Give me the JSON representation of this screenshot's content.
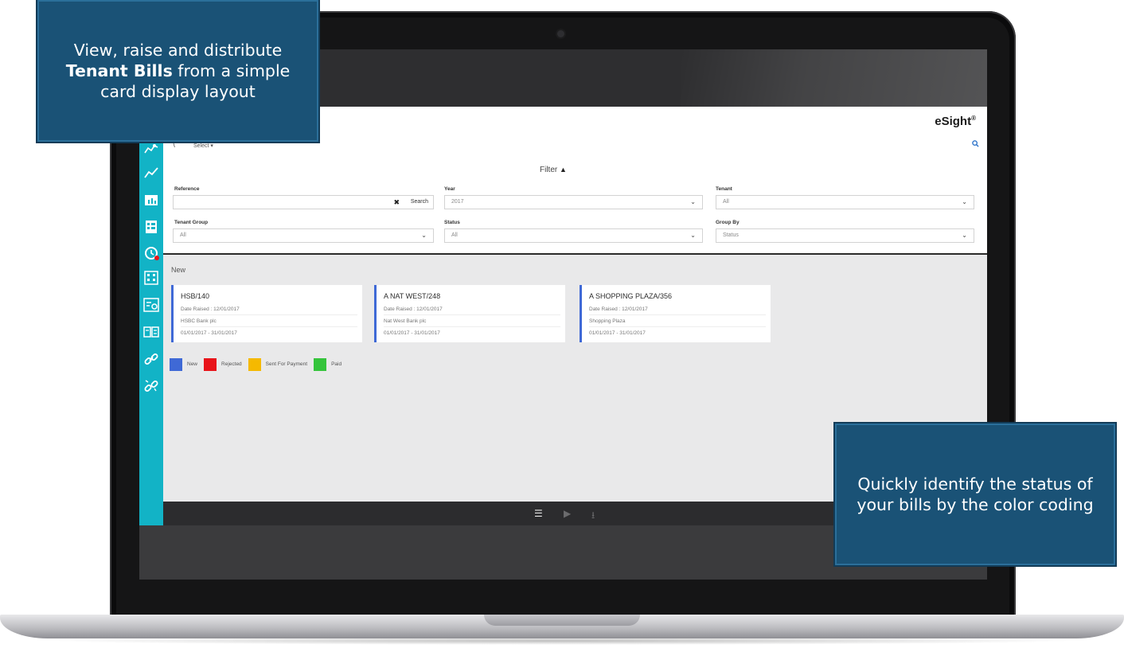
{
  "app": {
    "brand": "eSight",
    "brand_mark": "®",
    "toolbar": {
      "breadcrumb": "\\",
      "select_label": "Select ▾"
    },
    "filter": {
      "title": "Filter",
      "fields": {
        "reference": {
          "label": "Reference",
          "value": "",
          "search_label": "Search"
        },
        "year": {
          "label": "Year",
          "value": "2017"
        },
        "tenant": {
          "label": "Tenant",
          "value": "All"
        },
        "tenant_group": {
          "label": "Tenant Group",
          "value": "All"
        },
        "status": {
          "label": "Status",
          "value": "All"
        },
        "group_by": {
          "label": "Group By",
          "value": "Status"
        }
      }
    },
    "group_label": "New",
    "cards": [
      {
        "title": "HSB/140",
        "date_raised": "Date Raised : 12/01/2017",
        "tenant": "HSBC Bank plc",
        "period": "01/01/2017 - 31/01/2017",
        "status_color": "#3f69d6"
      },
      {
        "title": "A NAT WEST/248",
        "date_raised": "Date Raised : 12/01/2017",
        "tenant": "Nat West Bank plc",
        "period": "01/01/2017 - 31/01/2017",
        "status_color": "#3f69d6"
      },
      {
        "title": "A SHOPPING PLAZA/356",
        "date_raised": "Date Raised : 12/01/2017",
        "tenant": "Shopping Plaza",
        "period": "01/01/2017 - 31/01/2017",
        "status_color": "#3f69d6"
      }
    ],
    "legend": [
      {
        "label": "New",
        "color": "#3f69d6"
      },
      {
        "label": "Rejected",
        "color": "#e8141a"
      },
      {
        "label": "Sent For Payment",
        "color": "#f5b900"
      },
      {
        "label": "Paid",
        "color": "#35c43c"
      }
    ],
    "sidebar_icons": [
      "meters-icon",
      "trend-chart-icon",
      "report-folder-icon",
      "document-grid-icon",
      "alarm-icon",
      "building-icon",
      "tenant-bill-icon",
      "invoice-icon",
      "link-icon",
      "unlink-icon"
    ],
    "footer_icons": [
      "list-icon",
      "play-icon",
      "download-icon"
    ]
  },
  "callouts": {
    "top_left": {
      "pre": "View, raise and distribute ",
      "bold": "Tenant Bills",
      "post": " from a simple card display layout"
    },
    "bottom_right": {
      "text": "Quickly identify the status of your bills by the color coding"
    }
  }
}
